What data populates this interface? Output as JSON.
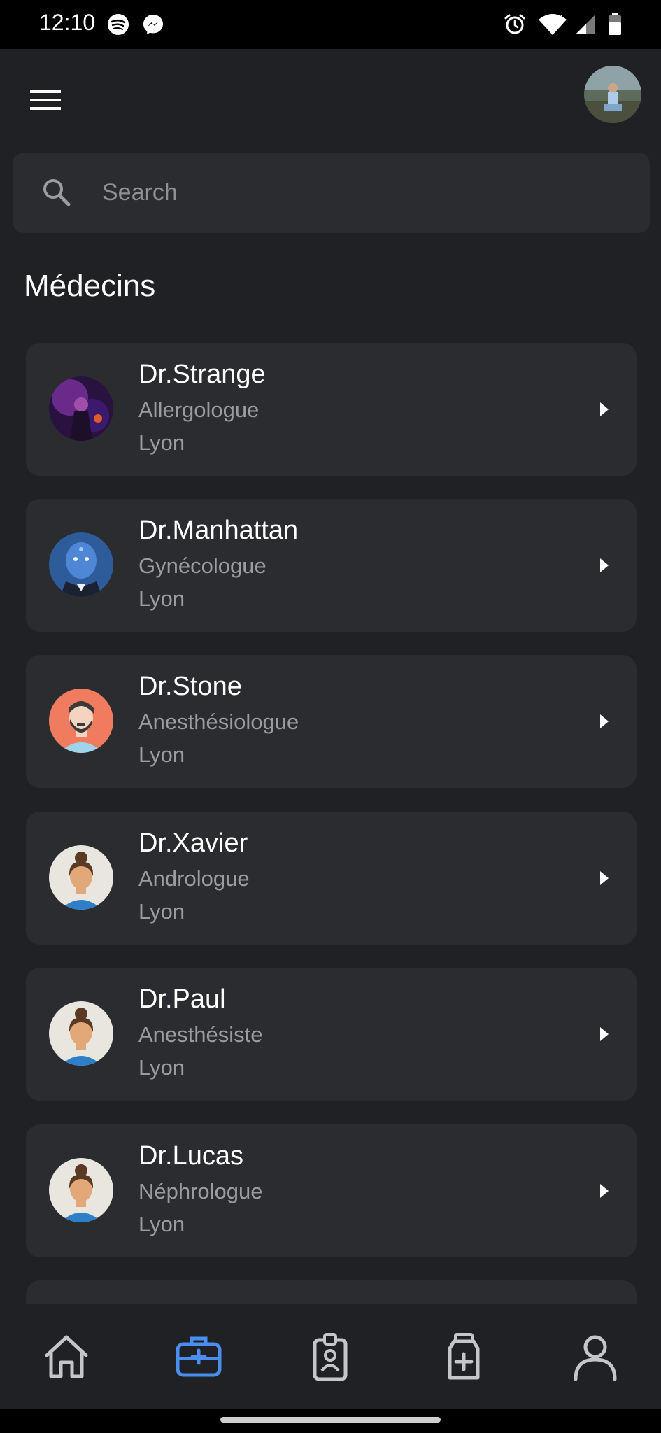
{
  "status_bar": {
    "time": "12:10",
    "icons": [
      "spotify-icon",
      "messenger-icon",
      "alarm-icon",
      "wifi-icon",
      "signal-icon",
      "battery-icon"
    ]
  },
  "header": {
    "menu_icon": "hamburger-menu-icon",
    "profile_avatar": "user-avatar"
  },
  "search": {
    "placeholder": "Search",
    "value": ""
  },
  "section": {
    "title": "Médecins"
  },
  "doctors": [
    {
      "name": "Dr.Strange",
      "specialty": "Allergologue",
      "city": "Lyon",
      "avatar": "photo-purple"
    },
    {
      "name": "Dr.Manhattan",
      "specialty": "Gynécologue",
      "city": "Lyon",
      "avatar": "photo-blue"
    },
    {
      "name": "Dr.Stone",
      "specialty": "Anesthésiologue",
      "city": "Lyon",
      "avatar": "illustration-man-bearded"
    },
    {
      "name": "Dr.Xavier",
      "specialty": "Andrologue",
      "city": "Lyon",
      "avatar": "illustration-woman"
    },
    {
      "name": "Dr.Paul",
      "specialty": "Anesthésiste",
      "city": "Lyon",
      "avatar": "illustration-woman"
    },
    {
      "name": "Dr.Lucas",
      "specialty": "Néphrologue",
      "city": "Lyon",
      "avatar": "illustration-woman"
    }
  ],
  "bottom_nav": {
    "items": [
      {
        "icon": "home-icon",
        "active": false
      },
      {
        "icon": "medical-kit-icon",
        "active": true
      },
      {
        "icon": "badge-icon",
        "active": false
      },
      {
        "icon": "medicine-bottle-icon",
        "active": false
      },
      {
        "icon": "profile-icon",
        "active": false
      }
    ]
  },
  "colors": {
    "background": "#202124",
    "card": "#2b2c2f",
    "text_primary": "#ffffff",
    "text_secondary": "#9a9ca0",
    "accent": "#4a8ef0",
    "nav_inactive": "#c4c6ca"
  }
}
